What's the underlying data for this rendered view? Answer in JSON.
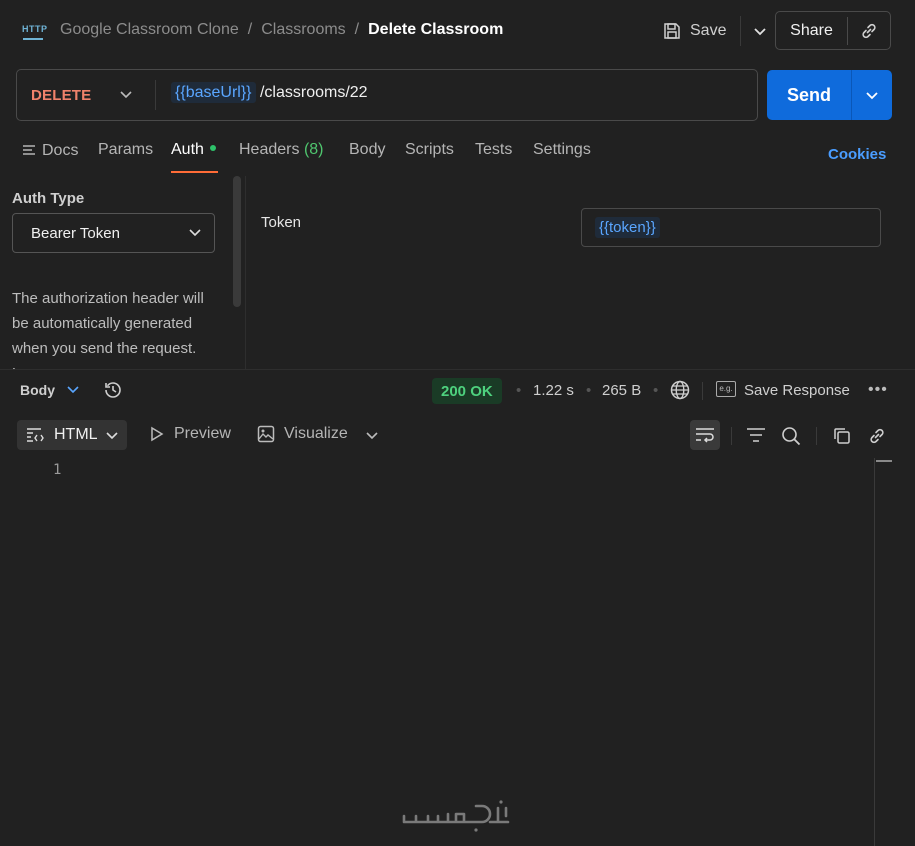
{
  "header": {
    "breadcrumbs": [
      "Google Classroom Clone",
      "Classrooms"
    ],
    "current": "Delete Classroom",
    "save_label": "Save",
    "share_label": "Share",
    "http_icon_text": "HTTP"
  },
  "request": {
    "method": "DELETE",
    "url_var": "{{baseUrl}}",
    "url_path": "/classrooms/22",
    "send_label": "Send"
  },
  "tabs": {
    "docs": "Docs",
    "params": "Params",
    "auth": "Auth",
    "headers": "Headers",
    "headers_count": "(8)",
    "body": "Body",
    "scripts": "Scripts",
    "tests": "Tests",
    "settings": "Settings",
    "cookies": "Cookies"
  },
  "auth": {
    "type_label": "Auth Type",
    "type_value": "Bearer Token",
    "description": "The authorization header will be automatically generated when you send the request. Learn more",
    "token_label": "Token",
    "token_value": "{{token}}"
  },
  "response": {
    "body_label": "Body",
    "status": "200 OK",
    "time": "1.22 s",
    "size": "265 B",
    "save_response": "Save Response",
    "eg_label": "e.g.",
    "format": "HTML",
    "preview": "Preview",
    "visualize": "Visualize",
    "line_number": "1"
  },
  "colors": {
    "method": "#f0826b",
    "send": "#0f6bdc",
    "status_ok": "#4ed17e",
    "accent_tab": "#ff6c37",
    "variable": "#5aa6ff",
    "cookies": "#4a9dff"
  }
}
